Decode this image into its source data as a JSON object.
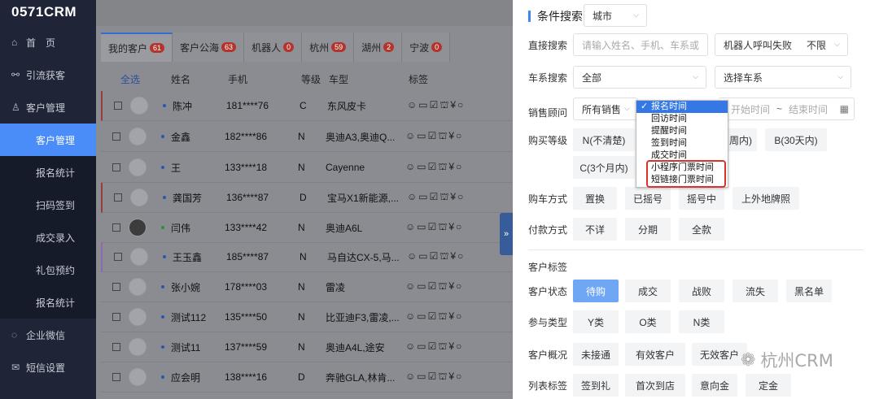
{
  "app": {
    "logo": "0571CRM"
  },
  "sidebar": {
    "items": [
      {
        "label": "首　页",
        "icon": "home-icon",
        "glyph": "⌂"
      },
      {
        "label": "引流获客",
        "icon": "funnel-icon",
        "glyph": "⚯"
      },
      {
        "label": "客户管理",
        "icon": "user-icon",
        "glyph": "♙"
      }
    ],
    "subitems": [
      "客户管理",
      "报名统计",
      "扫码签到",
      "成交录入",
      "礼包预约",
      "报名统计"
    ],
    "bottom": [
      {
        "label": "企业微信",
        "icon": "wechat-icon",
        "glyph": "◌"
      },
      {
        "label": "短信设置",
        "icon": "message-icon",
        "glyph": "✉"
      }
    ]
  },
  "tabs": [
    {
      "label": "我的客户",
      "count": "61"
    },
    {
      "label": "客户公海",
      "count": "63"
    },
    {
      "label": "机器人",
      "count": "0"
    },
    {
      "label": "杭州",
      "count": "59"
    },
    {
      "label": "湖州",
      "count": "2"
    },
    {
      "label": "宁波",
      "count": "0"
    }
  ],
  "table": {
    "headers": {
      "select_all": "全选",
      "name": "姓名",
      "phone": "手机",
      "level": "等级",
      "car": "车型",
      "tags": "标签"
    },
    "rows": [
      {
        "name": "陈冲",
        "phone": "181****76",
        "level": "C",
        "car": "东风皮卡",
        "tags": "☺▭☑⛫¥○"
      },
      {
        "name": "金鑫",
        "phone": "182****86",
        "level": "N",
        "car": "奥迪A3,奥迪Q...",
        "tags": "☺▭☑⛫¥○"
      },
      {
        "name": "王",
        "phone": "133****18",
        "level": "N",
        "car": "Cayenne",
        "tags": "☺▭☑⛫¥○"
      },
      {
        "name": "龚国芳",
        "phone": "136****87",
        "level": "D",
        "car": "宝马X1新能源,...",
        "tags": "☺▭☑⛫¥○"
      },
      {
        "name": "闫伟",
        "phone": "133****42",
        "level": "N",
        "car": "奥迪A6L",
        "tags": "☺▭☑⛫¥○"
      },
      {
        "name": "王玉鑫",
        "phone": "185****87",
        "level": "N",
        "car": "马自达CX-5,马...",
        "tags": "☺▭☑⛫¥○"
      },
      {
        "name": "张小婉",
        "phone": "178****03",
        "level": "N",
        "car": "雷凌",
        "tags": "☺▭☑⛫¥○"
      },
      {
        "name": "测试112",
        "phone": "135****50",
        "level": "N",
        "car": "比亚迪F3,雷凌,...",
        "tags": "☺▭☑⛫¥○"
      },
      {
        "name": "测试11",
        "phone": "137****59",
        "level": "N",
        "car": "奥迪A4L,途安",
        "tags": "☺▭☑⛫¥○"
      },
      {
        "name": "应会明",
        "phone": "138****16",
        "level": "D",
        "car": "奔驰GLA,林肯...",
        "tags": "☺▭☑⛫¥○"
      }
    ]
  },
  "panel": {
    "title": "条件搜索",
    "city_select": "城市",
    "direct_search": {
      "label": "直接搜索",
      "placeholder": "请输入姓名、手机、车系或店铺",
      "robot_select": "机器人呼叫失败",
      "robot_value": "不限"
    },
    "car_search": {
      "label": "车系搜索",
      "brand": "全部",
      "series_placeholder": "选择车系"
    },
    "consultant": {
      "label": "销售顾问",
      "value": "所有销售",
      "start_placeholder": "开始时间",
      "tilde": "~",
      "end_placeholder": "结束时间"
    },
    "purchase_level": {
      "label": "购买等级",
      "options": [
        "N(不清楚)",
        "周内)",
        "B(30天内)",
        "C(3个月内)"
      ]
    },
    "purchase_method": {
      "label": "购车方式",
      "options": [
        "置换",
        "已摇号",
        "摇号中",
        "上外地牌照"
      ]
    },
    "payment": {
      "label": "付款方式",
      "options": [
        "不详",
        "分期",
        "全款"
      ]
    },
    "tags_title": "客户标签",
    "status": {
      "label": "客户状态",
      "options": [
        "待购",
        "成交",
        "战败",
        "流失",
        "黑名单"
      ]
    },
    "participation": {
      "label": "参与类型",
      "options": [
        "Y类",
        "O类",
        "N类"
      ]
    },
    "overview": {
      "label": "客户概况",
      "options": [
        "未接通",
        "有效客户",
        "无效客户"
      ]
    },
    "list_tags": {
      "label": "列表标签",
      "options": [
        "签到礼",
        "首次到店",
        "意向金",
        "定金"
      ]
    }
  },
  "dropdown": {
    "items": [
      "报名时间",
      "回访时间",
      "提醒时间",
      "签到时间",
      "成交时间",
      "小程序门票时间",
      "短链接门票时间"
    ],
    "selected_index": 0
  },
  "expand_toggle": "»",
  "watermark": "杭州CRM",
  "colors": {
    "accent": "#3e86f5",
    "sidebar": "#1f2537",
    "highlight_box": "#d9322b"
  }
}
